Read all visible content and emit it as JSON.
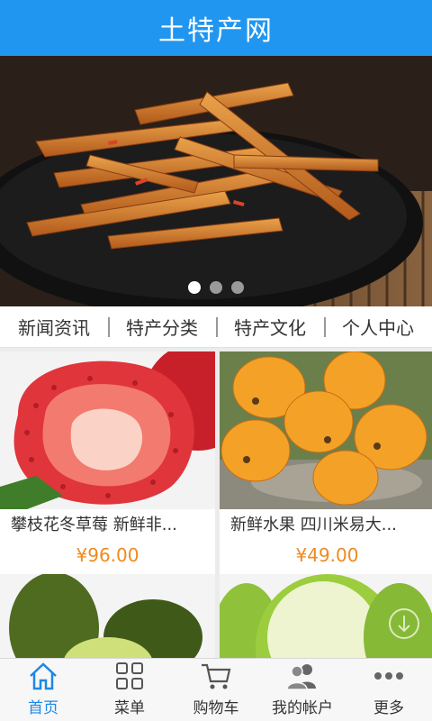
{
  "app": {
    "title": "土特产网"
  },
  "banner": {
    "dots": 3,
    "active_dot": 0
  },
  "categories": [
    {
      "label": "新闻资讯"
    },
    {
      "label": "特产分类"
    },
    {
      "label": "特产文化"
    },
    {
      "label": "个人中心"
    }
  ],
  "products": [
    {
      "name": "攀枝花冬草莓 新鲜非...",
      "price": "¥96.00"
    },
    {
      "name": "新鲜水果 四川米易大...",
      "price": "¥49.00"
    },
    {
      "name": "",
      "price": ""
    },
    {
      "name": "",
      "price": ""
    }
  ],
  "tabs": [
    {
      "label": "首页",
      "icon": "home-icon",
      "active": true
    },
    {
      "label": "菜单",
      "icon": "grid-menu-icon",
      "active": false
    },
    {
      "label": "购物车",
      "icon": "cart-icon",
      "active": false
    },
    {
      "label": "我的帐户",
      "icon": "users-icon",
      "active": false
    },
    {
      "label": "更多",
      "icon": "more-dots-icon",
      "active": false
    }
  ],
  "colors": {
    "header": "#2196f0",
    "price": "#f08a1e",
    "active_tab": "#1e88e5"
  }
}
